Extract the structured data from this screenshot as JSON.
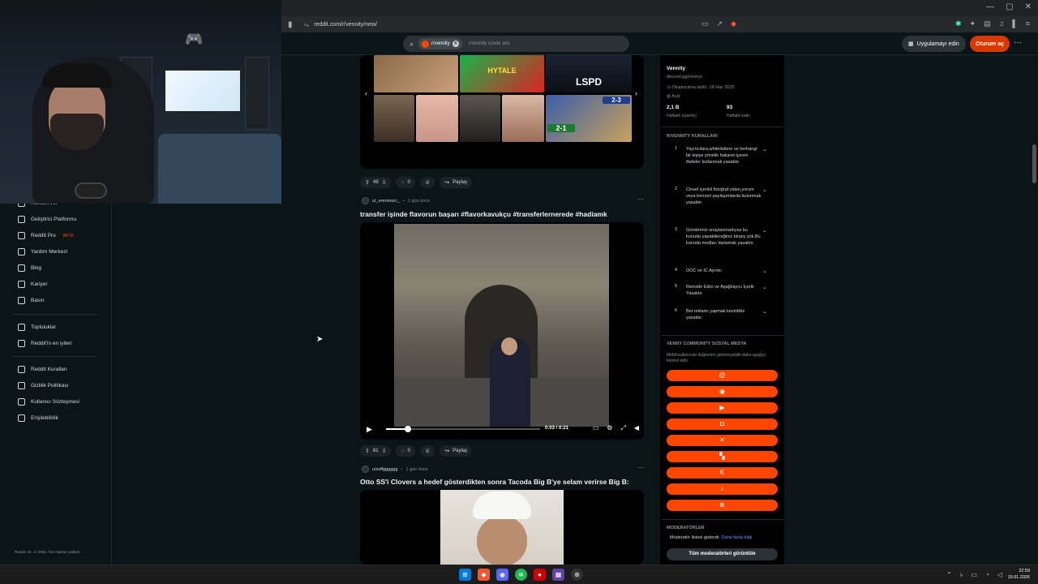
{
  "browser": {
    "url": "reddit.com/r/vennity/new/"
  },
  "header": {
    "search_chip": "r/vennity",
    "search_placeholder": "r/vennity içinde ara",
    "app_button": "Uygulamayı edin",
    "login_button": "Oturum aç"
  },
  "left_nav": {
    "items": [
      {
        "label": "Reklam ver",
        "icon": "megaphone-icon"
      },
      {
        "label": "Geliştirici Platformu",
        "icon": "code-icon"
      },
      {
        "label": "Reddit Pro",
        "badge": "BETA",
        "icon": "pro-icon"
      },
      {
        "label": "Yardım Merkezi",
        "icon": "help-icon"
      },
      {
        "label": "Blog",
        "icon": "book-icon"
      },
      {
        "label": "Kariyer",
        "icon": "briefcase-icon"
      },
      {
        "label": "Basın",
        "icon": "mic-icon"
      }
    ],
    "items2": [
      {
        "label": "Topluluklar",
        "icon": "communities-icon"
      },
      {
        "label": "Reddit'in en iyileri",
        "icon": "star-icon"
      }
    ],
    "items3": [
      {
        "label": "Reddit Kuralları",
        "icon": "rules-icon"
      },
      {
        "label": "Gizlilik Politikası",
        "icon": "privacy-icon"
      },
      {
        "label": "Kullanıcı Sözleşmesi",
        "icon": "agreement-icon"
      },
      {
        "label": "Erişilebilirlik",
        "icon": "accessibility-icon"
      }
    ],
    "footer": "Reddit, Inc. © 2026. Tüm hakları saklıdır."
  },
  "posts": [
    {
      "gallery_labels": {
        "hytale": "HYTALE",
        "lspd": "LSPD",
        "score": "2-3",
        "score2": "2-1"
      },
      "votes": "49",
      "comments": "0",
      "share": "Paylaş"
    },
    {
      "author": "u/_erenmurc_",
      "time": "1 gün önce",
      "title": "transfer işinde flavorun başarı #flavorkavukçu #transferlernerede #hadiamk",
      "video_time": "0:03 / 0:21",
      "video_progress": 0.14,
      "votes": "81",
      "comments": "0",
      "share": "Paylaş"
    },
    {
      "author": "u/ssffgggggg",
      "time": "1 gün önce",
      "title": "Otto SS'i Clovers a hedef gösterdikten sonra Tacoda Big B'ye selam verirse Big B:"
    }
  ],
  "sidebar": {
    "name": "Vennity",
    "link": "discord.gg/vennyv",
    "created": "Oluşturulma tarihi: 18 Haz 2025",
    "visibility": "Açık",
    "stat1_value": "2,1 B",
    "stat1_label": "Haftalık ziyaretçi",
    "stat2_value": "93",
    "stat2_label": "Haftalık katkı",
    "rules_title": "R/VENNITY KURALLARI",
    "rules": [
      {
        "num": "1",
        "text": "Yayıncılara,whitelistlere ve herhangi bir kişiye yönelik hakaret içeren ifadeler kullanmak yasaktır."
      },
      {
        "num": "2",
        "text": "Cinsel içerikli fotoğraf,video,yorum veya benzeri paylaşımlarda bulunmak yasaktır."
      },
      {
        "num": "3",
        "text": "Gönderiniz onaylanmadıysa bu konuda yapabileceğiniz birşey yok.Bu konuda modları darlamak yasaktır."
      },
      {
        "num": "4",
        "text": "OOC ve IC Ayrımı"
      },
      {
        "num": "5",
        "text": "Rencide Edici ve Aşağılayıcı İçerik Yasaktır"
      },
      {
        "num": "6",
        "text": "Bet reklamı yapmak kesinlikle yasaktır."
      }
    ],
    "social_title": "VENNY COMMUNITY SOSYAL MEDYA",
    "social_note": "Mobil kullanıcılar düğmeleri göremeyebilir;daha aşağıyı kontrol edin.",
    "social_icons": [
      "threads-icon",
      "discord-icon",
      "youtube-icon",
      "instagram-icon",
      "x-icon",
      "twitch-icon",
      "kick-icon",
      "tiktok-icon",
      "steam-icon"
    ],
    "mods_title": "MODERATÖRLER",
    "mods_note": "Moderatör listesi gizlendi.",
    "mods_link": "Daha fazla bilgi",
    "mods_button": "Tüm moderatörleri görüntüle",
    "accent": "#ff4500"
  },
  "taskbar": {
    "time": "22:59",
    "date": "19.01.2026"
  }
}
